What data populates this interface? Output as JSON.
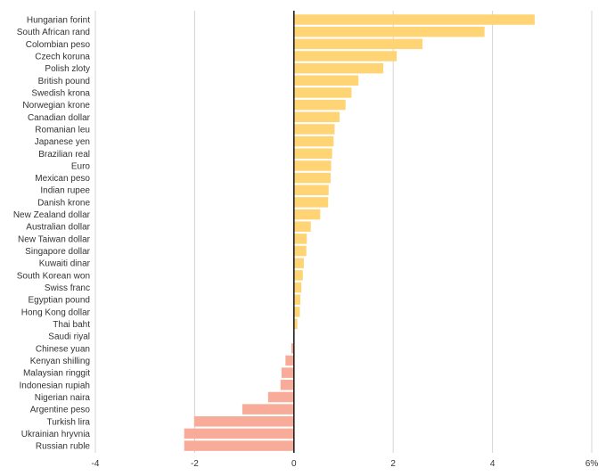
{
  "chart_data": {
    "type": "bar",
    "orientation": "horizontal",
    "title": "",
    "xlabel": "",
    "ylabel": "",
    "xlim": [
      -4,
      6
    ],
    "x_ticks": [
      -4,
      -2,
      0,
      2,
      4,
      6
    ],
    "x_tick_labels": [
      "-4",
      "-2",
      "0",
      "2",
      "4",
      "6%"
    ],
    "grid": true,
    "colors": {
      "positive": "#FFD475",
      "negative": "#F8AB98"
    },
    "categories": [
      "Hungarian forint",
      "South African rand",
      "Colombian peso",
      "Czech koruna",
      "Polish zloty",
      "British pound",
      "Swedish krona",
      "Norwegian krone",
      "Canadian dollar",
      "Romanian leu",
      "Japanese yen",
      "Brazilian real",
      "Euro",
      "Mexican peso",
      "Indian rupee",
      "Danish krone",
      "New Zealand dollar",
      "Australian dollar",
      "New Taiwan dollar",
      "Singapore dollar",
      "Kuwaiti dinar",
      "South Korean won",
      "Swiss franc",
      "Egyptian pound",
      "Hong Kong dollar",
      "Thai baht",
      "Saudi riyal",
      "Chinese yuan",
      "Kenyan shilling",
      "Malaysian ringgit",
      "Indonesian rupiah",
      "Nigerian naira",
      "Argentine peso",
      "Turkish lira",
      "Ukrainian hryvnia",
      "Russian ruble"
    ],
    "values": [
      4.85,
      3.84,
      2.59,
      2.07,
      1.8,
      1.3,
      1.16,
      1.04,
      0.92,
      0.82,
      0.8,
      0.77,
      0.75,
      0.74,
      0.7,
      0.69,
      0.53,
      0.34,
      0.26,
      0.25,
      0.2,
      0.18,
      0.15,
      0.13,
      0.12,
      0.07,
      0.01,
      -0.05,
      -0.17,
      -0.25,
      -0.27,
      -0.52,
      -1.04,
      -2.01,
      -2.21,
      -2.21
    ]
  }
}
